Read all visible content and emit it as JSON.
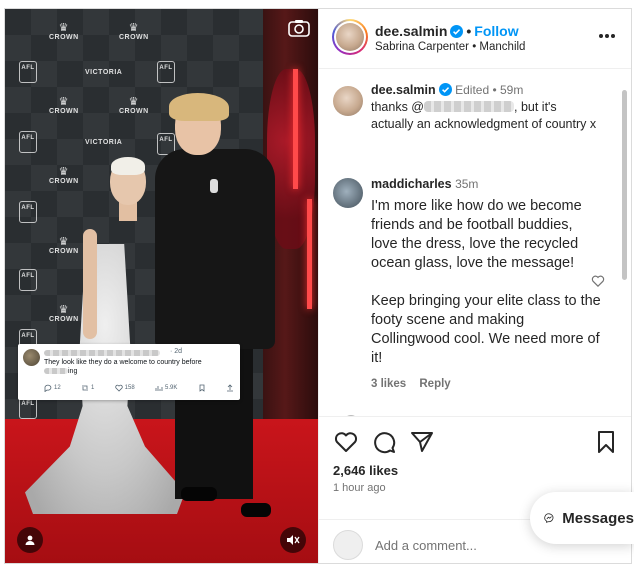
{
  "post": {
    "username": "dee.salmin",
    "follow_label": "Follow",
    "subtitle_left": "Sabrina Carpenter",
    "subtitle_right": "Manchild",
    "likes": "2,646 likes",
    "time_ago": "1 hour ago"
  },
  "media": {
    "logos": {
      "crown": "CROWN",
      "afl": "AFL",
      "victoria": "VICTORIA"
    },
    "tweet": {
      "time": "· 2d",
      "text_line1": "They look like they do a welcome to country before",
      "text_line2_suffix": "ing",
      "replies": "12",
      "retweets": "1",
      "likes": "158",
      "views": "5.9K"
    }
  },
  "comments": [
    {
      "username": "dee.salmin",
      "meta": "Edited • 59m",
      "text_prefix": "thanks @",
      "text_suffix": ", but it's actually an acknowledgment of country x"
    },
    {
      "username": "maddicharles",
      "meta": "35m",
      "text_p1": "I'm more like how do we become friends and be football buddies, love the dress, love the recycled ocean glass, love the message!",
      "text_p2": "Keep bringing your elite class to the footy scene and making Collingwood cool. We need more of it!",
      "likes": "3 likes",
      "reply_label": "Reply"
    }
  ],
  "add_comment": {
    "placeholder": "Add a comment..."
  },
  "messages": {
    "label": "Messages"
  },
  "colors": {
    "accent": "#0095f6",
    "verified": "#0095f6",
    "carpet": "#c9151b"
  },
  "icons": [
    "camera-icon",
    "user-tag-icon",
    "mute-icon",
    "heart-icon",
    "comment-icon",
    "share-icon",
    "bookmark-icon",
    "more-icon",
    "verified-icon",
    "messenger-icon"
  ]
}
